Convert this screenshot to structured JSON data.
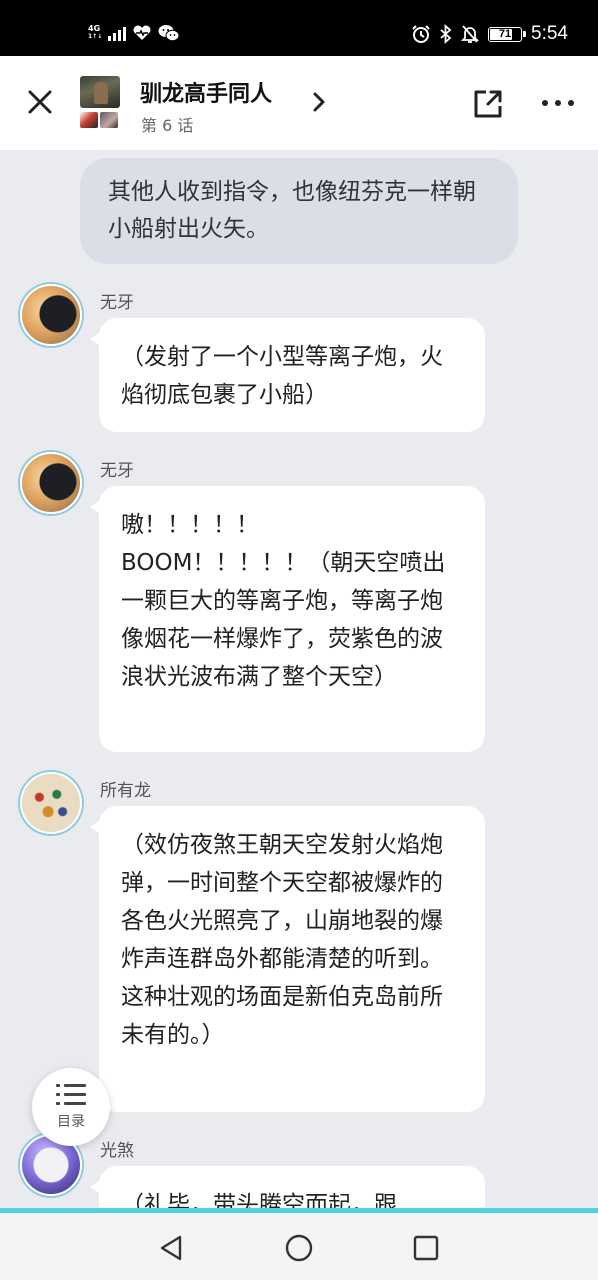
{
  "status_bar": {
    "network": "4G",
    "network_sub": "1↑↓",
    "battery": "71",
    "time": "5:54"
  },
  "header": {
    "title": "驯龙高手同人",
    "episode": "第 6 话"
  },
  "narration": "其他人收到指令，也像纽芬克一样朝小船射出火矢。",
  "messages": [
    {
      "sender": "无牙",
      "avatar": "toothless-avatar",
      "text": "（发射了一个小型等离子炮，火焰彻底包裹了小船）"
    },
    {
      "sender": "无牙",
      "avatar": "toothless-avatar",
      "text": "嗷！！！！！\nBOOM！！！！！（朝天空喷出一颗巨大的等离子炮，等离子炮像烟花一样爆炸了，荧紫色的波浪状光波布满了整个天空）"
    },
    {
      "sender": "所有龙",
      "avatar": "all-dragons-avatar",
      "text": "（效仿夜煞王朝天空发射火焰炮弹，一时间整个天空都被爆炸的各色火光照亮了，山崩地裂的爆炸声连群岛外都能清楚的听到。这种壮观的场面是新伯克岛前所未有的。）"
    },
    {
      "sender": "光煞",
      "avatar": "light-fury-avatar",
      "text": "（礼毕，带头腾空而起，跟"
    }
  ],
  "toc": {
    "label": "目录"
  },
  "colors": {
    "background": "#e9ebef",
    "narration_bubble": "#dadfe7",
    "accent_line": "#4fd1e0"
  }
}
